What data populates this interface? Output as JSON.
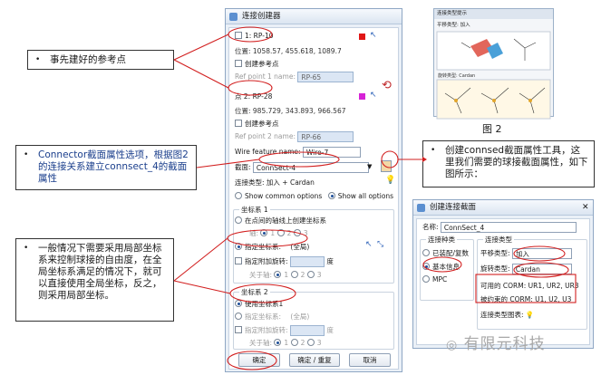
{
  "notes": {
    "ref_points": "事先建好的参考点",
    "connector": "Connector截面属性选项，根据图2的连接关系建立connsect_4的截面属性",
    "coord": "一般情况下需要采用局部坐标系来控制球接的自由度，在全局坐标系满足的情况下，就可以直接使用全局坐标，反之，则采用局部坐标。",
    "create_section": "创建connsed截面属性工具，这里我们需要的球接截面属性，如下图所示："
  },
  "dialog": {
    "title": "连接创建器",
    "point1_label": "1: RP-10",
    "point1_pos": "位置: 1058.57, 455.618, 1089.7",
    "create_ref": "创建参考点",
    "ref1_name_label": "Ref point 1 name:",
    "ref1_name": "RP-65",
    "point2_label": "点 2: RP-28",
    "point2_pos": "位置: 985.729, 343.893, 966.567",
    "ref2_name_label": "Ref point 2 name:",
    "ref2_name": "RP-66",
    "wire_label": "Wire feature name:",
    "wire_name": "Wire-7",
    "section_label": "截面:",
    "section_value": "ConnSect-4",
    "conn_type": "连接类型: 加入 + Cardan",
    "show_common": "Show common options",
    "show_all": "Show all options",
    "cs1_title": "坐标系 1",
    "cs1_opt1": "在点间的轴线上创建坐标系",
    "axis_label": "轴:",
    "axis_1": "1",
    "axis_2": "2",
    "axis_3": "3",
    "cs1_opt2": "指定坐标系:",
    "global": "(全局)",
    "extra_rot": "指定附加旋转:",
    "deg": "度",
    "about_axis": "关于轴:",
    "cs2_title": "坐标系 2",
    "cs2_use": "使用坐标系1",
    "ok": "确定",
    "ok_reset": "确定 / 重复",
    "cancel": "取消"
  },
  "dialog2": {
    "title": "创建连接截面",
    "name_label": "名称:",
    "name_value": "ConnSect_4",
    "kind_title": "连接种类",
    "kind_opt1": "已装配/复数",
    "kind_opt2": "基本信息",
    "kind_opt3": "MPC",
    "type_title": "连接类型",
    "translate_label": "平移类型:",
    "translate_value": "加入",
    "rotate_label": "旋转类型:",
    "rotate_value": "Cardan",
    "avail_label": "可用的 CORM:",
    "avail_value": "UR1, UR2, UR3",
    "constrained_label": "被约束的 CORM:",
    "constrained_value": "U1, U2, U3",
    "diagram_label": "连接类型图表:"
  },
  "figure": {
    "title": "连接类型提示",
    "sub": "平移类型: 加入",
    "sub2": "旋转类型: Cardan",
    "caption": "图 2"
  },
  "watermark": "有限元科技",
  "colors": {
    "accent": "#d21f1f",
    "blue": "#1d4f9a"
  }
}
